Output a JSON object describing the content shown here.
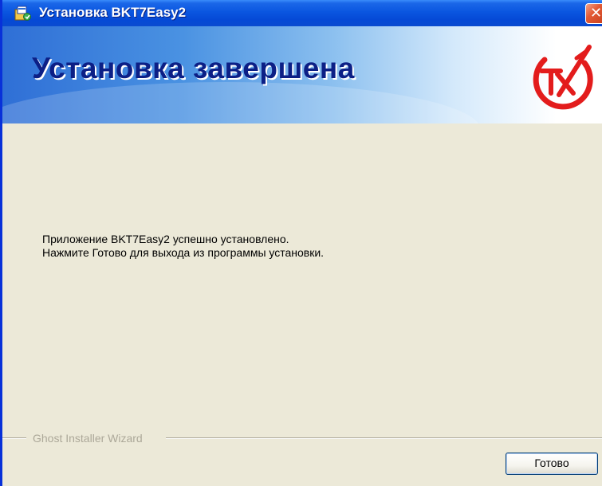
{
  "window": {
    "title": "Установка BKT7Easy2",
    "icon": "installer-icon",
    "close_icon": "close-icon"
  },
  "banner": {
    "heading": "Установка завершена",
    "logo": "bkt-logo-icon"
  },
  "message": {
    "line1": "Приложение BKT7Easy2 успешно установлено.",
    "line2": "Нажмите Готово для выхода из программы установки."
  },
  "footer": {
    "group_label": "Ghost Installer Wizard",
    "finish_label": "Готово"
  },
  "colors": {
    "titlebar": "#0549d6",
    "heading": "#0c1f86",
    "logo": "#e31c1c",
    "background": "#ece9d8"
  }
}
